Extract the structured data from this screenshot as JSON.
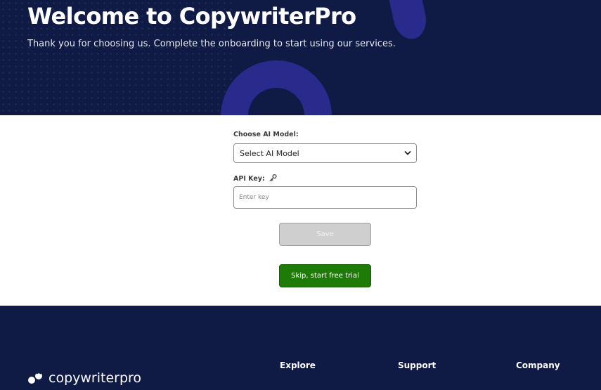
{
  "hero": {
    "title": "Welcome to CopywriterPro",
    "subtitle": "Thank you for choosing us. Complete the onboarding to start using our services."
  },
  "form": {
    "model_label": "Choose AI Model:",
    "model_selected": "Select AI Model",
    "api_key_label": "API Key:",
    "api_key_icon": "key-icon",
    "api_key_placeholder": "Enter key",
    "api_key_value": "",
    "save_label": "Save",
    "save_enabled": false,
    "skip_label": "Skip, start free trial"
  },
  "footer": {
    "logo_text": "copywriterpro",
    "columns": [
      "Explore",
      "Support",
      "Company"
    ]
  },
  "colors": {
    "navy": "#0f1a45",
    "accent_purple": "#2a2a8c",
    "green": "#1e7b07",
    "disabled_gray": "#cfcfcf"
  }
}
